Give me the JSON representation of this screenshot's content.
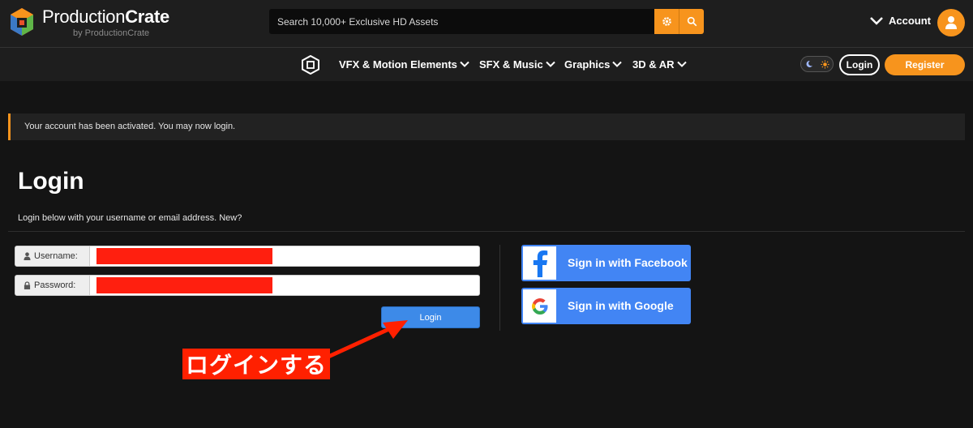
{
  "header": {
    "brand_bold": "Production",
    "brand_strong": "Crate",
    "brand_sub": "by ProductionCrate",
    "search_placeholder": "Search 10,000+ Exclusive HD Assets",
    "search_settings_icon": "gear-icon",
    "search_icon": "search-icon",
    "account_label": "Account",
    "avatar_icon": "user-icon"
  },
  "nav": {
    "items": [
      {
        "label": "VFX & Motion Elements"
      },
      {
        "label": "SFX & Music"
      },
      {
        "label": "Graphics"
      },
      {
        "label": "3D & AR"
      }
    ],
    "theme_toggle_icons": [
      "moon-icon",
      "sun-icon"
    ],
    "login_label": "Login",
    "register_label": "Register"
  },
  "alert": {
    "message": "Your account has been activated. You may now login."
  },
  "login": {
    "title": "Login",
    "intro": "Login below with your username or email address. New?",
    "username_label": "Username:",
    "password_label": "Password:",
    "submit_label": "Login"
  },
  "social": {
    "facebook_label": "Sign in with Facebook",
    "google_label": "Sign in with Google"
  },
  "annotation": {
    "text": "ログインする"
  },
  "colors": {
    "accent_orange": "#f7941d",
    "button_blue": "#3d8ae8",
    "social_blue": "#4285f4",
    "annotation_red": "#ff2000",
    "background": "#141414"
  }
}
